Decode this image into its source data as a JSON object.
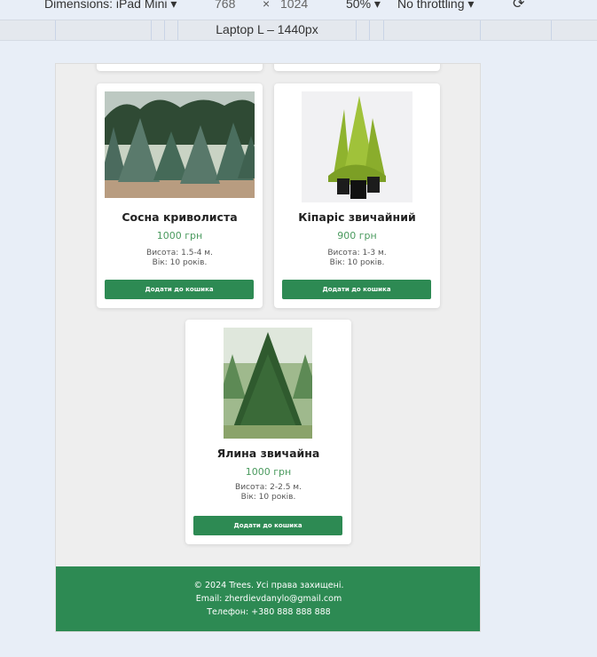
{
  "devtools": {
    "dimensions_label": "Dimensions: iPad Mini",
    "width": "768",
    "times": "×",
    "height": "1024",
    "zoom": "50%",
    "throttling": "No throttling",
    "media_query_label": "Laptop L – 1440px"
  },
  "products": [
    {
      "name": "Сосна криволиста",
      "price": "1000 грн",
      "height": "Висота: 1.5-4 м.",
      "age": "Вік: 10 років.",
      "button": "Додати до кошика",
      "image": "pine-field"
    },
    {
      "name": "Кіпаріс звичайний",
      "price": "900 грн",
      "height": "Висота: 1-3 м.",
      "age": "Вік: 10 років.",
      "button": "Додати до кошика",
      "image": "cypress-pots"
    },
    {
      "name": "Ялина звичайна",
      "price": "1000 грн",
      "height": "Висота: 2-2.5 м.",
      "age": "Вік: 10 років.",
      "button": "Додати до кошика",
      "image": "spruce-tree"
    }
  ],
  "footer": {
    "copyright": "© 2024 Trees. Усі права захищені.",
    "email": "Email: zherdievdanylo@gmail.com",
    "phone": "Телефон: +380 888 888 888"
  },
  "colors": {
    "accent": "#2d8a53",
    "price": "#4a9a5e"
  }
}
